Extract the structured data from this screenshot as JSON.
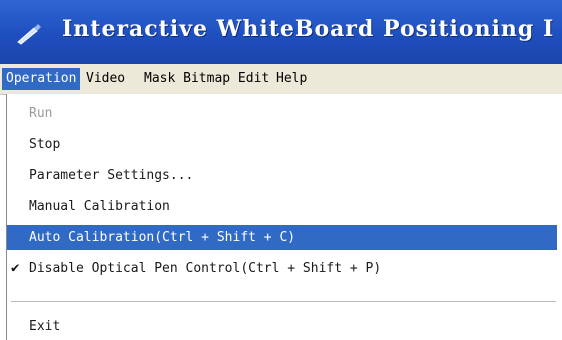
{
  "window": {
    "title": "Interactive WhiteBoard Positioning I",
    "icon": "pen-icon"
  },
  "menubar": {
    "items": [
      "Operation",
      "Video",
      "Mask Bitmap Edit",
      "Help"
    ],
    "active": "Operation"
  },
  "dropdown": {
    "items": [
      {
        "label": "Run",
        "state": "disabled"
      },
      {
        "label": "Stop"
      },
      {
        "label": "Parameter Settings..."
      },
      {
        "label": "Manual Calibration"
      },
      {
        "label": "Auto Calibration(Ctrl + Shift + C)",
        "state": "highlighted"
      },
      {
        "label": "Disable Optical Pen Control(Ctrl + Shift + P)",
        "checked": true
      },
      {
        "label": "Exit"
      }
    ]
  },
  "colors": {
    "titlebar": "#2f65d3",
    "highlight": "#316ac5",
    "menubar": "#ece9d8"
  }
}
